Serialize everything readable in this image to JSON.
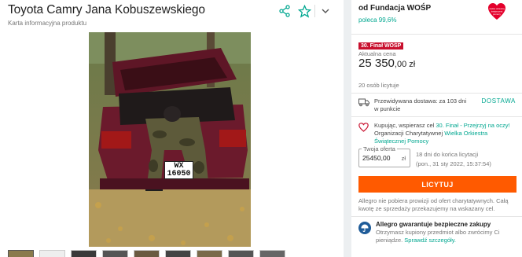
{
  "product": {
    "title": "Toyota Camry Jana Kobuszewskiego",
    "subtitle": "Karta informacyjna produktu",
    "plate_line1": "WX",
    "plate_line2": "16050"
  },
  "header_icons": [
    "share-icon",
    "star-icon",
    "chevron-down-icon"
  ],
  "seller": {
    "name": "od Fundacja WOŚP",
    "recommend": "poleca 99,6%",
    "logo_text": "wielka orkiestra świątecznej pomocy"
  },
  "offer": {
    "badge": "30. Finał WOŚP",
    "price_label": "Aktualna cena",
    "price_main": "25 350",
    "price_cents": ",00 zł",
    "bought": "20 osób licytuje",
    "delivery_text": "Przewidywana dostawa: za 103 dni w punkcie",
    "delivery_link": "DOSTAWA",
    "charity_prefix": "Kupując, wspierasz cel ",
    "charity_link": "30. Finał - Przejrzyj na oczy!",
    "charity_middle": " Organizacji Charytatywnej ",
    "charity_org": "Wielka Orkiestra Świątecznej Pomocy",
    "your_offer_label": "Twoja oferta",
    "your_offer_value": "25450,00",
    "currency": "zł",
    "auction_line1": "18 dni do końca licytacji",
    "auction_line2": "(pon., 31 sty 2022, 15:37:54)",
    "bid_button": "LICYTUJ",
    "commission": "Allegro nie pobiera prowizji od ofert charytatywnych. Całą kwotę ze sprzedaży przekazujemy na wskazany cel.",
    "guarantee_head": "Allegro gwarantuje bezpieczne zakupy",
    "guarantee_body": "Otrzymasz kupiony przedmiot albo zwrócimy Ci pieniądze. ",
    "guarantee_link": "Sprawdź szczegóły."
  },
  "colors": {
    "accent": "#ff5a00",
    "link": "#00a790",
    "badge": "#c8102e"
  }
}
